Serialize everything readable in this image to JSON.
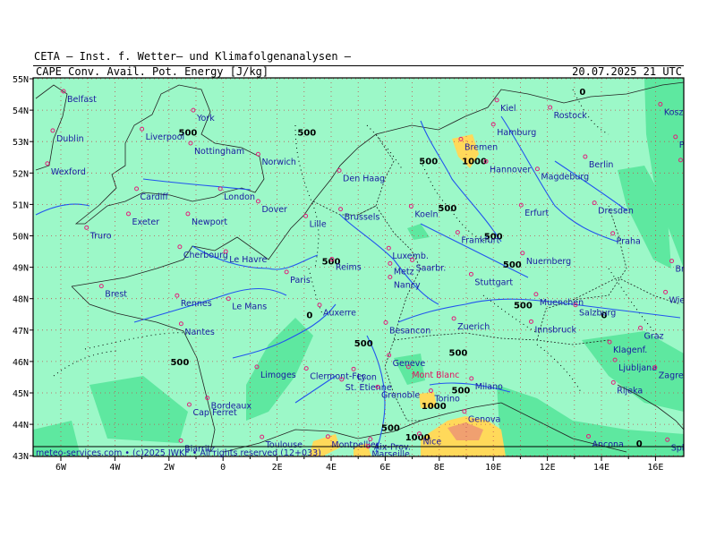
{
  "header": {
    "org": "CETA — Inst. f. Wetter— und Klimafolgenanalysen —",
    "title": "CAPE Conv. Avail. Pot. Energy [J/kg]",
    "datetime": "20.07.2025 21 UTC"
  },
  "footer": {
    "text": "meteo-services.com • (c)2025 IWKF • All rights reserved (12+033)"
  },
  "axes": {
    "lat_labels": [
      "55N",
      "54N",
      "53N",
      "52N",
      "51N",
      "50N",
      "49N",
      "48N",
      "47N",
      "46N",
      "45N",
      "44N",
      "43N"
    ],
    "lon_labels": [
      "6W",
      "4W",
      "2W",
      "0",
      "2E",
      "4E",
      "6E",
      "8E",
      "10E",
      "12E",
      "14E",
      "16E"
    ]
  },
  "colors": {
    "cape_low": "#9cf8c8",
    "cape_mid": "#5ee8a0",
    "cape_high": "#ffd95a",
    "cape_peak": "#f0a070",
    "rivers": "#2255ee",
    "borders": "#222222",
    "grid": "#c05050",
    "city_marker": "#e0207a"
  },
  "cities": [
    {
      "name": "Belfast",
      "lon": -5.9,
      "lat": 54.6
    },
    {
      "name": "Dublin",
      "lon": -6.3,
      "lat": 53.35
    },
    {
      "name": "Wexford",
      "lon": -6.5,
      "lat": 52.3
    },
    {
      "name": "Liverpool",
      "lon": -3.0,
      "lat": 53.4
    },
    {
      "name": "York",
      "lon": -1.1,
      "lat": 54.0
    },
    {
      "name": "Nottingham",
      "lon": -1.2,
      "lat": 52.95
    },
    {
      "name": "Norwich",
      "lon": 1.3,
      "lat": 52.6
    },
    {
      "name": "Cardiff",
      "lon": -3.2,
      "lat": 51.5
    },
    {
      "name": "London",
      "lon": -0.1,
      "lat": 51.5
    },
    {
      "name": "Dover",
      "lon": 1.3,
      "lat": 51.1
    },
    {
      "name": "Exeter",
      "lon": -3.5,
      "lat": 50.7
    },
    {
      "name": "Newport",
      "lon": -1.3,
      "lat": 50.7
    },
    {
      "name": "Truro",
      "lon": -5.05,
      "lat": 50.26
    },
    {
      "name": "Cherbourg",
      "lon": -1.6,
      "lat": 49.65
    },
    {
      "name": "Le Havre",
      "lon": 0.1,
      "lat": 49.5
    },
    {
      "name": "Brest",
      "lon": -4.5,
      "lat": 48.4
    },
    {
      "name": "Rennes",
      "lon": -1.7,
      "lat": 48.1
    },
    {
      "name": "Le Mans",
      "lon": 0.2,
      "lat": 48.0
    },
    {
      "name": "Paris",
      "lon": 2.35,
      "lat": 48.85
    },
    {
      "name": "Nantes",
      "lon": -1.55,
      "lat": 47.2
    },
    {
      "name": "Limoges",
      "lon": 1.25,
      "lat": 45.83
    },
    {
      "name": "Bordeaux",
      "lon": -0.58,
      "lat": 44.84
    },
    {
      "name": "Cap Ferret",
      "lon": -1.25,
      "lat": 44.63
    },
    {
      "name": "Biarritz",
      "lon": -1.56,
      "lat": 43.48
    },
    {
      "name": "Toulouse",
      "lon": 1.44,
      "lat": 43.6
    },
    {
      "name": "Montpellier",
      "lon": 3.88,
      "lat": 43.61
    },
    {
      "name": "Lille",
      "lon": 3.06,
      "lat": 50.63
    },
    {
      "name": "Den Haag",
      "lon": 4.3,
      "lat": 52.08
    },
    {
      "name": "Brussels",
      "lon": 4.35,
      "lat": 50.85
    },
    {
      "name": "Reims",
      "lon": 4.03,
      "lat": 49.26
    },
    {
      "name": "Auxerre",
      "lon": 3.57,
      "lat": 47.8
    },
    {
      "name": "Clermont-Fer.",
      "lon": 3.08,
      "lat": 45.78
    },
    {
      "name": "Lyon",
      "lon": 4.83,
      "lat": 45.76
    },
    {
      "name": "St. Etienne",
      "lon": 4.39,
      "lat": 45.43
    },
    {
      "name": "Grenoble",
      "lon": 5.72,
      "lat": 45.19
    },
    {
      "name": "Aix-Prov.",
      "lon": 5.45,
      "lat": 43.53
    },
    {
      "name": "Marseille",
      "lon": 5.37,
      "lat": 43.3
    },
    {
      "name": "Nice",
      "lon": 7.26,
      "lat": 43.7
    },
    {
      "name": "Luxemb.",
      "lon": 6.13,
      "lat": 49.61
    },
    {
      "name": "Metz",
      "lon": 6.18,
      "lat": 49.12
    },
    {
      "name": "Saarbr.",
      "lon": 7.0,
      "lat": 49.23
    },
    {
      "name": "Nancy",
      "lon": 6.18,
      "lat": 48.69
    },
    {
      "name": "Besancon",
      "lon": 6.02,
      "lat": 47.24
    },
    {
      "name": "Geneve",
      "lon": 6.14,
      "lat": 46.2
    },
    {
      "name": "Mont Blanc",
      "lon": 6.86,
      "lat": 45.83,
      "special": true
    },
    {
      "name": "Torino",
      "lon": 7.69,
      "lat": 45.07
    },
    {
      "name": "Genova",
      "lon": 8.93,
      "lat": 44.41
    },
    {
      "name": "Milano",
      "lon": 9.19,
      "lat": 45.46
    },
    {
      "name": "Zuerich",
      "lon": 8.54,
      "lat": 47.37
    },
    {
      "name": "Stuttgart",
      "lon": 9.18,
      "lat": 48.78
    },
    {
      "name": "Frankfurt",
      "lon": 8.68,
      "lat": 50.11
    },
    {
      "name": "Koeln",
      "lon": 6.96,
      "lat": 50.94
    },
    {
      "name": "Bremen",
      "lon": 8.8,
      "lat": 53.08
    },
    {
      "name": "Hamburg",
      "lon": 10.0,
      "lat": 53.55
    },
    {
      "name": "Kiel",
      "lon": 10.13,
      "lat": 54.32
    },
    {
      "name": "Hannover",
      "lon": 9.73,
      "lat": 52.37
    },
    {
      "name": "Rostock",
      "lon": 12.1,
      "lat": 54.09
    },
    {
      "name": "Magdeburg",
      "lon": 11.63,
      "lat": 52.13
    },
    {
      "name": "Berlin",
      "lon": 13.4,
      "lat": 52.52
    },
    {
      "name": "Erfurt",
      "lon": 11.03,
      "lat": 50.98
    },
    {
      "name": "Dresden",
      "lon": 13.74,
      "lat": 51.05
    },
    {
      "name": "Nuernberg",
      "lon": 11.08,
      "lat": 49.45
    },
    {
      "name": "Muenchen",
      "lon": 11.58,
      "lat": 48.14
    },
    {
      "name": "Salzburg",
      "lon": 13.04,
      "lat": 47.8
    },
    {
      "name": "Innsbruck",
      "lon": 11.4,
      "lat": 47.27
    },
    {
      "name": "Praha",
      "lon": 14.42,
      "lat": 50.08
    },
    {
      "name": "Brno",
      "lon": 16.6,
      "lat": 49.2
    },
    {
      "name": "Wien",
      "lon": 16.37,
      "lat": 48.21
    },
    {
      "name": "Graz",
      "lon": 15.44,
      "lat": 47.07
    },
    {
      "name": "Klagenf.",
      "lon": 14.3,
      "lat": 46.62
    },
    {
      "name": "Ljubljana",
      "lon": 14.5,
      "lat": 46.05
    },
    {
      "name": "Zagreb",
      "lon": 15.98,
      "lat": 45.81
    },
    {
      "name": "Rijeka",
      "lon": 14.44,
      "lat": 45.33
    },
    {
      "name": "Ancona",
      "lon": 13.52,
      "lat": 43.62
    },
    {
      "name": "Split",
      "lon": 16.44,
      "lat": 43.51
    },
    {
      "name": "Koszalin",
      "lon": 16.18,
      "lat": 54.19
    },
    {
      "name": "Pila",
      "lon": 16.74,
      "lat": 53.15
    },
    {
      "name": "Poznan",
      "lon": 16.93,
      "lat": 52.41
    }
  ],
  "contour_labels": [
    {
      "text": "0",
      "lon": 13.3,
      "lat": 54.6
    },
    {
      "text": "500",
      "lon": 3.1,
      "lat": 53.3
    },
    {
      "text": "500",
      "lon": -1.3,
      "lat": 53.3
    },
    {
      "text": "500",
      "lon": 7.6,
      "lat": 52.4
    },
    {
      "text": "1000",
      "lon": 9.3,
      "lat": 52.4
    },
    {
      "text": "500",
      "lon": 8.3,
      "lat": 50.9
    },
    {
      "text": "500",
      "lon": 10.0,
      "lat": 50.0
    },
    {
      "text": "500",
      "lon": 4.0,
      "lat": 49.2
    },
    {
      "text": "500",
      "lon": 10.7,
      "lat": 49.1
    },
    {
      "text": "500",
      "lon": 11.1,
      "lat": 47.8
    },
    {
      "text": "0",
      "lon": 3.2,
      "lat": 47.5
    },
    {
      "text": "0",
      "lon": 14.1,
      "lat": 47.5
    },
    {
      "text": "500",
      "lon": 5.2,
      "lat": 46.6
    },
    {
      "text": "500",
      "lon": 8.7,
      "lat": 46.3
    },
    {
      "text": "500",
      "lon": -1.6,
      "lat": 46.0
    },
    {
      "text": "500",
      "lon": 8.8,
      "lat": 45.1
    },
    {
      "text": "1000",
      "lon": 7.8,
      "lat": 44.6
    },
    {
      "text": "500",
      "lon": 6.2,
      "lat": 43.9
    },
    {
      "text": "1000",
      "lon": 7.2,
      "lat": 43.6
    },
    {
      "text": "0",
      "lon": 15.4,
      "lat": 43.4
    }
  ]
}
